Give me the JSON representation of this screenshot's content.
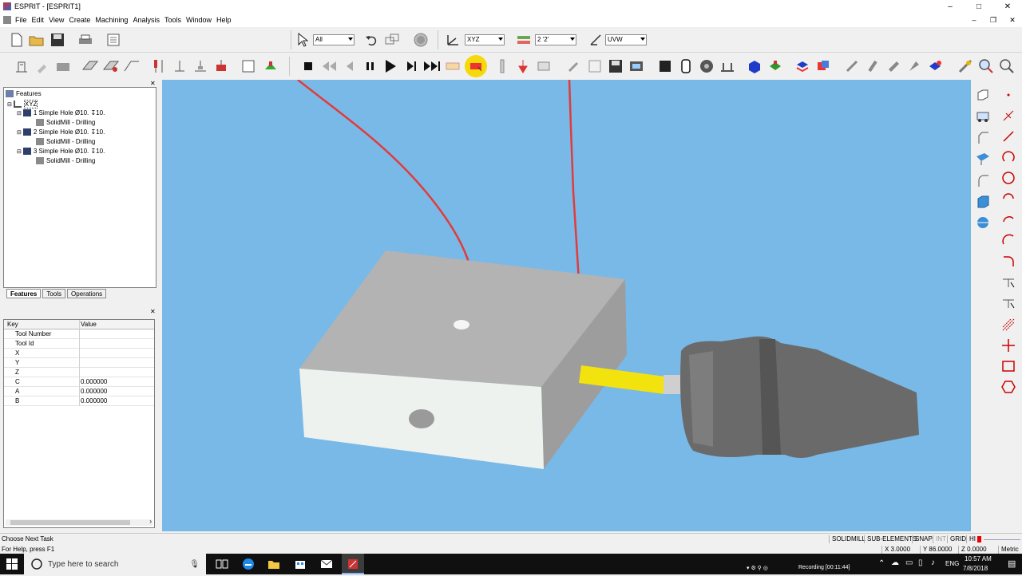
{
  "window": {
    "title": "ESPRIT - [ESPRIT1]",
    "minimize": "–",
    "maximize": "□",
    "close": "✕"
  },
  "menu": {
    "items": [
      "File",
      "Edit",
      "View",
      "Create",
      "Machining",
      "Analysis",
      "Tools",
      "Window",
      "Help"
    ],
    "mdi_min": "–",
    "mdi_restore": "❐",
    "mdi_close": "✕"
  },
  "toolbar": {
    "filter_select": "All",
    "workplane_select": "XYZ",
    "layer_select": "2 '2'",
    "uvw_select": "UVW"
  },
  "tree": {
    "title": "Features",
    "root": "XYZ",
    "items": [
      {
        "label": "1 Simple Hole Ø10. ↧10.",
        "child": "SolidMill - Drilling"
      },
      {
        "label": "2 Simple Hole Ø10. ↧10.",
        "child": "SolidMill - Drilling"
      },
      {
        "label": "3 Simple Hole Ø10. ↧10.",
        "child": "SolidMill - Drilling"
      }
    ]
  },
  "tabs": [
    "Features",
    "Tools",
    "Operations"
  ],
  "properties": {
    "headers": [
      "Key",
      "Value"
    ],
    "rows": [
      {
        "key": "Tool Number",
        "value": ""
      },
      {
        "key": "Tool Id",
        "value": ""
      },
      {
        "key": "X",
        "value": ""
      },
      {
        "key": "Y",
        "value": ""
      },
      {
        "key": "Z",
        "value": ""
      },
      {
        "key": "C",
        "value": "0.000000"
      },
      {
        "key": "A",
        "value": "0.000000"
      },
      {
        "key": "B",
        "value": "0.000000"
      }
    ]
  },
  "status": {
    "line1": "Choose Next Task",
    "line2": "For Help, press F1",
    "panes": [
      "SOLIDMILL",
      "SUB-ELEMENTS",
      "SNAP",
      "INT",
      "GRID",
      "HI"
    ],
    "x": "X 3.0000",
    "y": "Y 86.0000",
    "z": "Z 0.0000",
    "units": "Metric"
  },
  "taskbar": {
    "search_placeholder": "Type here to search",
    "recording": "Recording [00:11:44]",
    "lang": "ENG",
    "time": "10:57 AM",
    "date": "7/8/2018"
  },
  "colors": {
    "viewport_bg": "#79b9e8",
    "toolpath": "#e23b3b",
    "tool_yellow": "#f2e30f",
    "highlight": "#f5d90a"
  }
}
